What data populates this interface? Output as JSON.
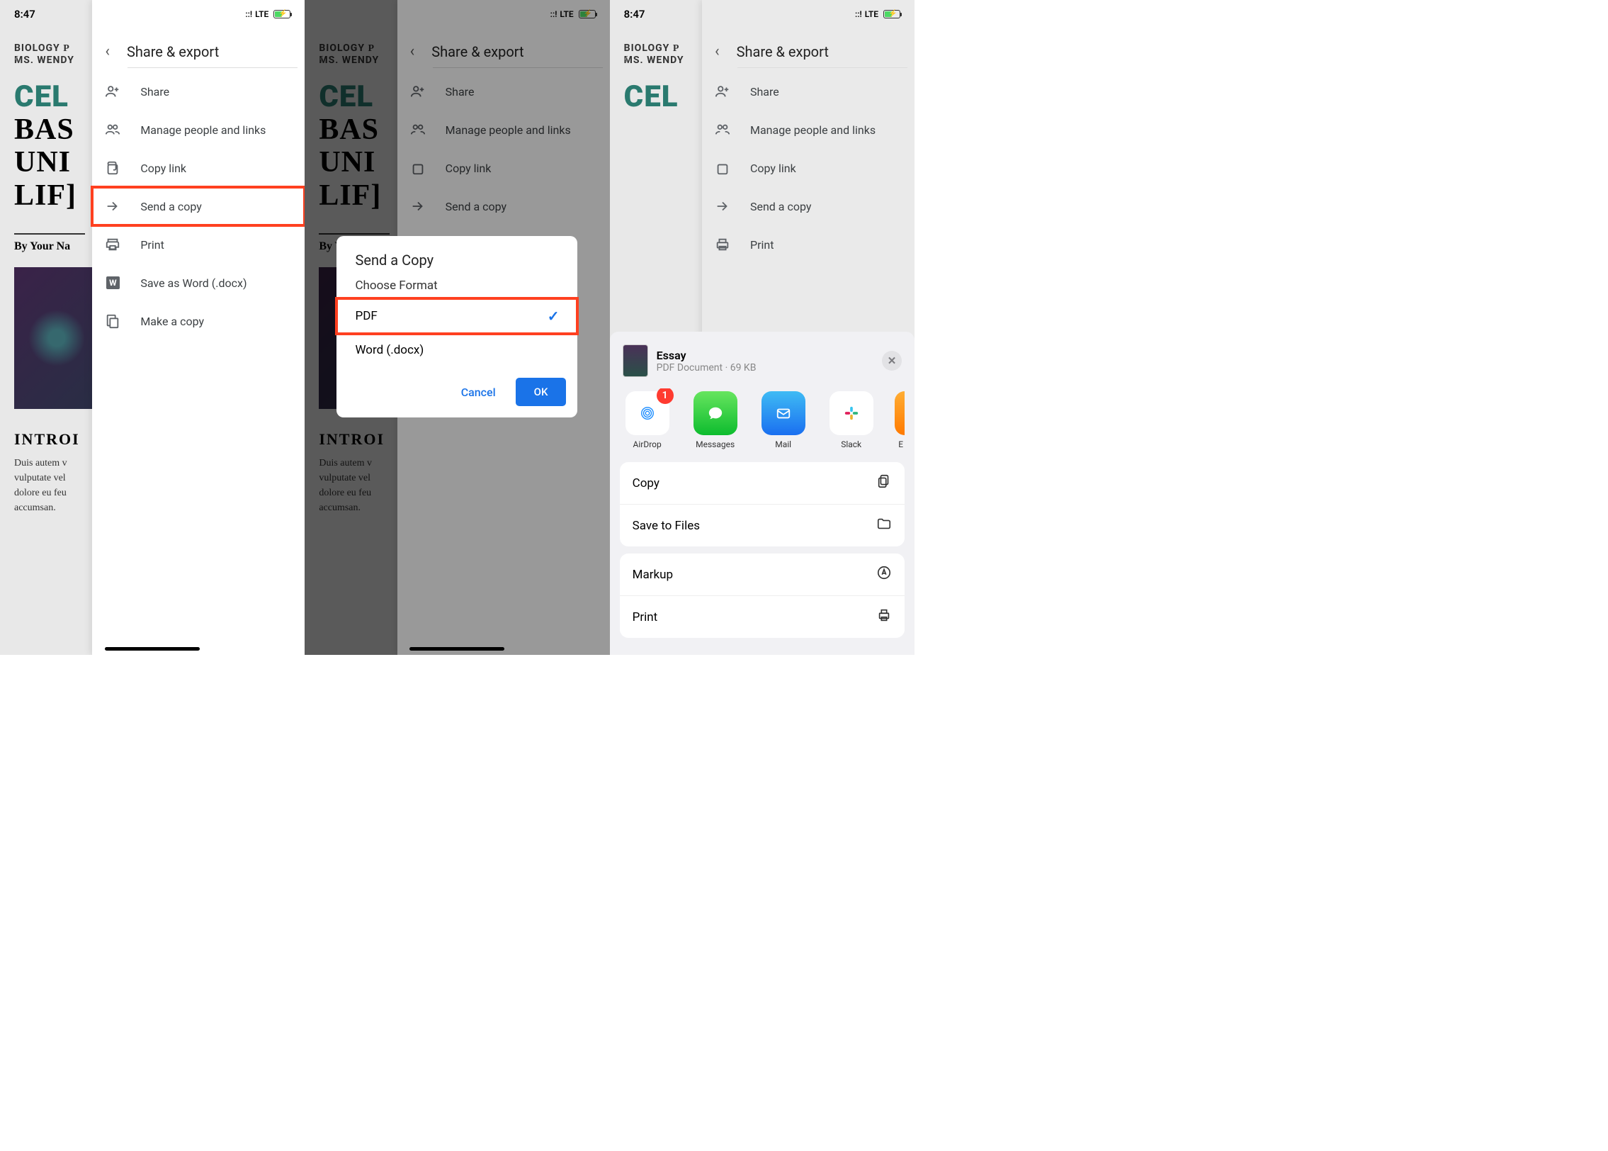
{
  "status": {
    "time": "8:47",
    "network": "LTE",
    "signal": "::!"
  },
  "doc": {
    "subject": "BIOLOGY",
    "teacher": "MS. WENDY",
    "title_green": "CEL",
    "title_rest": "BAS\nUNI\nLIFE",
    "byline": "By Your Na",
    "intro": "INTROI",
    "body": "Duis autem v\nvulputate vel\ndolore eu feu\naccumsan."
  },
  "panel": {
    "title": "Share & export",
    "items": [
      {
        "icon": "person-add",
        "label": "Share"
      },
      {
        "icon": "people",
        "label": "Manage people and links"
      },
      {
        "icon": "link",
        "label": "Copy link"
      },
      {
        "icon": "send",
        "label": "Send a copy"
      },
      {
        "icon": "print",
        "label": "Print"
      },
      {
        "icon": "word",
        "label": "Save as Word (.docx)"
      },
      {
        "icon": "copy",
        "label": "Make a copy"
      }
    ]
  },
  "dialog": {
    "title": "Send a Copy",
    "subtitle": "Choose Format",
    "opt_pdf": "PDF",
    "opt_word": "Word (.docx)",
    "cancel": "Cancel",
    "ok": "OK"
  },
  "sheet": {
    "name": "Essay",
    "meta": "PDF Document · 69 KB",
    "apps": {
      "airdrop": "AirDrop",
      "messages": "Messages",
      "mail": "Mail",
      "slack": "Slack"
    },
    "badge": "1",
    "actions": {
      "copy": "Copy",
      "save": "Save to Files",
      "markup": "Markup",
      "print": "Print"
    }
  }
}
